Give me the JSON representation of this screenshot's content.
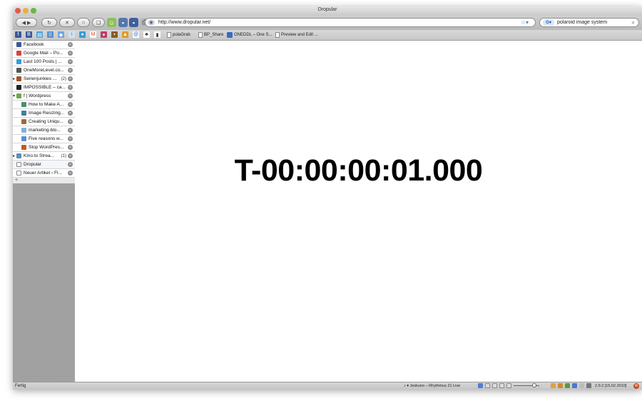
{
  "window": {
    "title": "Dropular"
  },
  "nav": {
    "back_icon": "back-arrow-icon",
    "forward_icon": "forward-arrow-icon",
    "reload_icon": "reload-icon",
    "stop_icon": "stop-icon",
    "home_icon": "home-icon",
    "url": "http://www.dropular.net/",
    "search_query": "polaroid image system"
  },
  "bookmarks": {
    "items": [
      {
        "label": "polaGrab"
      },
      {
        "label": "BP_Share"
      },
      {
        "label": "ONEDDL – One S..."
      },
      {
        "label": "Preview and Edit ..."
      }
    ]
  },
  "tabs": [
    {
      "label": "Facebook",
      "icon": "facebook-icon",
      "color": "#3b5998",
      "indent": 0
    },
    {
      "label": "Google Mail – Po...",
      "icon": "gmail-icon",
      "color": "#d44638",
      "indent": 0
    },
    {
      "label": "Last 100 Posts | ...",
      "icon": "bird-icon",
      "color": "#3a9ad9",
      "indent": 0
    },
    {
      "label": "OneMoreLevel.co...",
      "icon": "box-icon",
      "color": "#555555",
      "indent": 0
    },
    {
      "label": "Serienjunkies ...",
      "count": "(2)",
      "icon": "tv-icon",
      "color": "#a0522d",
      "indent": 0,
      "group": true
    },
    {
      "label": "IMPOSSIBLE – ca...",
      "icon": "q-icon",
      "color": "#222222",
      "indent": 0
    },
    {
      "label": "f | Wordpress",
      "icon": "leaf-icon",
      "color": "#6aa84f",
      "indent": 0,
      "group": true,
      "open": true
    },
    {
      "label": "How to Make A...",
      "icon": "page-icon",
      "color": "#4b8f6e",
      "indent": 1
    },
    {
      "label": "Image Resizing...",
      "icon": "page-icon",
      "color": "#3f7f9f",
      "indent": 1
    },
    {
      "label": "Creating Uniqu...",
      "icon": "page-icon",
      "color": "#9a6b3a",
      "indent": 1
    },
    {
      "label": "marketing-blo...",
      "icon": "feather-icon",
      "color": "#7fb2d8",
      "indent": 1
    },
    {
      "label": "Five reasons w...",
      "icon": "page-icon",
      "color": "#5a8fd0",
      "indent": 1
    },
    {
      "label": "Stop WordPres...",
      "icon": "wp-icon",
      "color": "#c05a1e",
      "indent": 1
    },
    {
      "label": "Kino.to Strea...",
      "count": "(1)",
      "icon": "film-icon",
      "color": "#5a8fb8",
      "indent": 0,
      "group": true
    },
    {
      "label": "Dropular",
      "icon": "blank-page-icon",
      "color": "#ffffff",
      "indent": 0,
      "selected": true
    },
    {
      "label": "Neuer Artikel ‹ Fl...",
      "icon": "blank-page-icon",
      "color": "#ffffff",
      "indent": 0
    }
  ],
  "content": {
    "countdown": "T-00:00:00:01.000"
  },
  "status": {
    "text": "Fertig",
    "music": "♪ ▾ Jeskuno – Rhythmus 21 Live",
    "version": "2.9.2 [15.02.2010]"
  }
}
